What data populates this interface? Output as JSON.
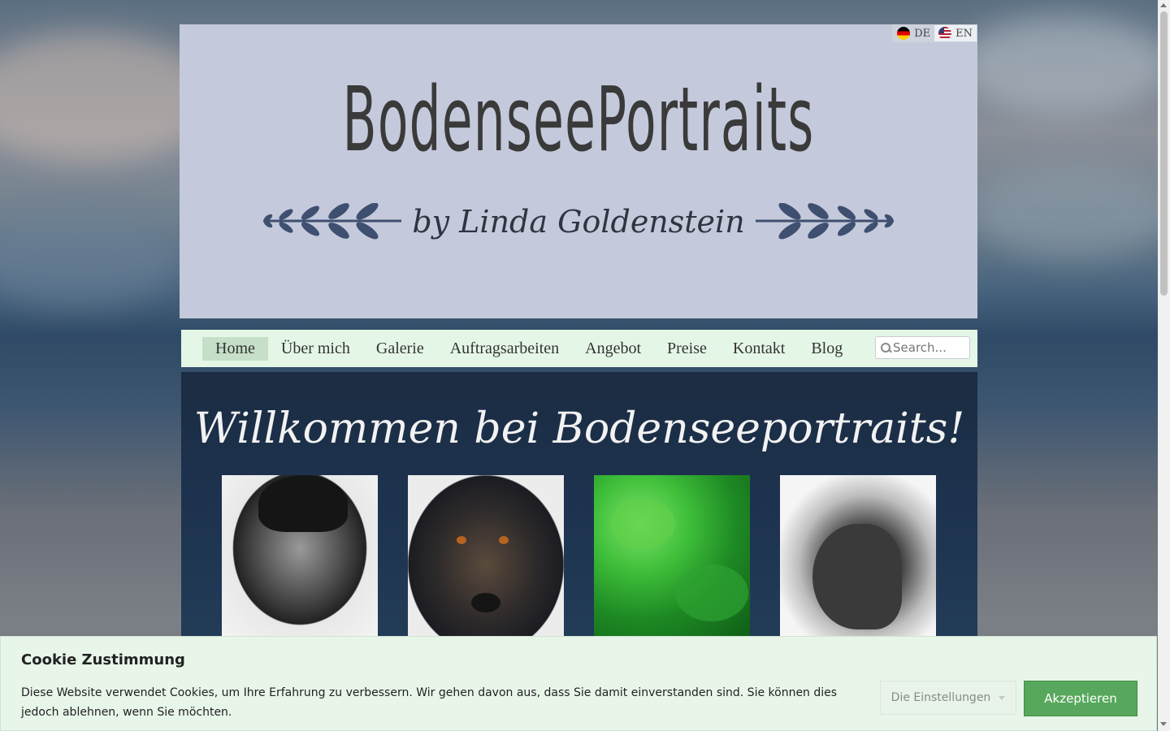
{
  "header": {
    "title": "BodenseePortraits",
    "byline": "by Linda Goldenstein",
    "languages": [
      {
        "code": "DE",
        "icon": "german-flag-icon",
        "active": true
      },
      {
        "code": "EN",
        "icon": "us-flag-icon",
        "active": false
      }
    ]
  },
  "nav": {
    "items": [
      "Home",
      "Über mich",
      "Galerie",
      "Auftragsarbeiten",
      "Angebot",
      "Preise",
      "Kontakt",
      "Blog"
    ],
    "active": "Home",
    "search_placeholder": "Search..."
  },
  "main": {
    "welcome": "Willkommen bei Bodenseeportraits!",
    "thumbnails": [
      "elvis-portrait-drawing",
      "dog-portrait-drawing",
      "green-leaves-drawing",
      "horse-portrait-drawing"
    ]
  },
  "cookie": {
    "title": "Cookie Zustimmung",
    "text": "Diese Website verwendet Cookies, um Ihre Erfahrung zu verbessern. Wir gehen davon aus, dass Sie damit einverstanden sind. Sie können dies jedoch ablehnen, wenn Sie möchten.",
    "settings_label": "Die Einstellungen",
    "accept_label": "Akzeptieren"
  },
  "colors": {
    "header_bg": "#c4cadb",
    "nav_bg": "#e4f7e7",
    "nav_active": "#c6dfc8",
    "content_bg": "#1d3350",
    "accept_button": "#57a85c",
    "cookie_bg": "#e8f6ea"
  }
}
